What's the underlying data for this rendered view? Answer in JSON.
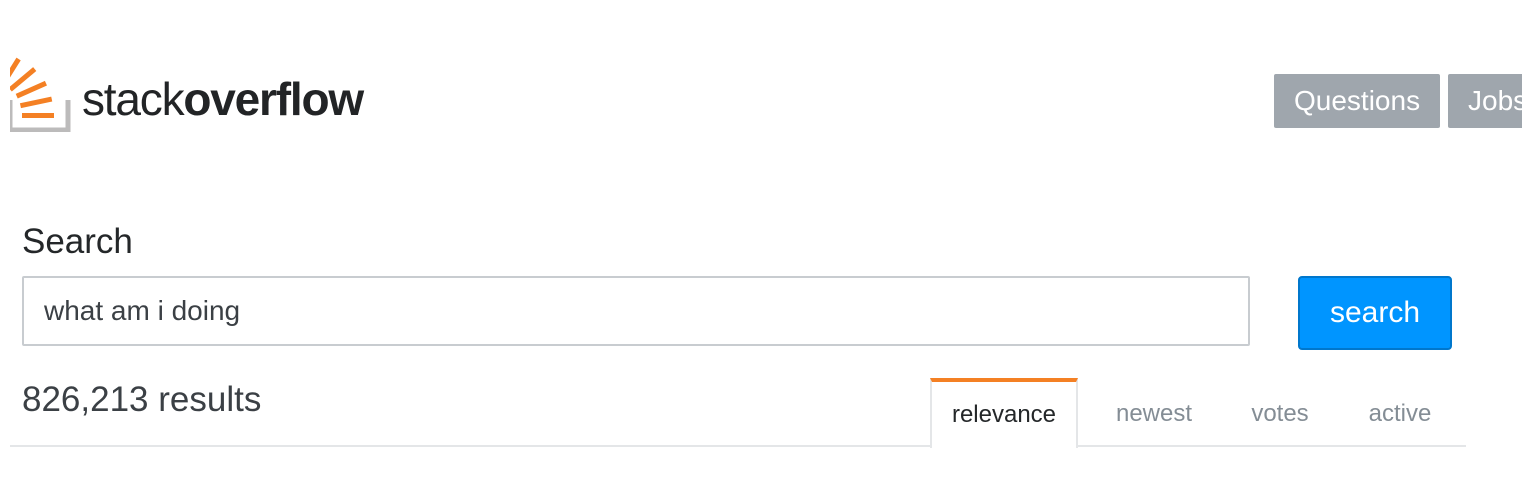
{
  "header": {
    "logo": {
      "text_light": "stack",
      "text_bold": "overflow",
      "mark_icon": "stackoverflow-logo-icon",
      "accent_color": "#f48024",
      "tray_color": "#bcbbbb"
    },
    "nav": {
      "questions_label": "Questions",
      "jobs_label": "Jobs"
    }
  },
  "search": {
    "heading": "Search",
    "query": "what am i doing",
    "button_label": "search",
    "button_color": "#0095ff"
  },
  "results": {
    "count_text": "826,213 results",
    "tabs": [
      {
        "label": "relevance",
        "active": true
      },
      {
        "label": "newest",
        "active": false
      },
      {
        "label": "votes",
        "active": false
      },
      {
        "label": "active",
        "active": false
      }
    ],
    "active_tab_accent": "#f48024"
  }
}
